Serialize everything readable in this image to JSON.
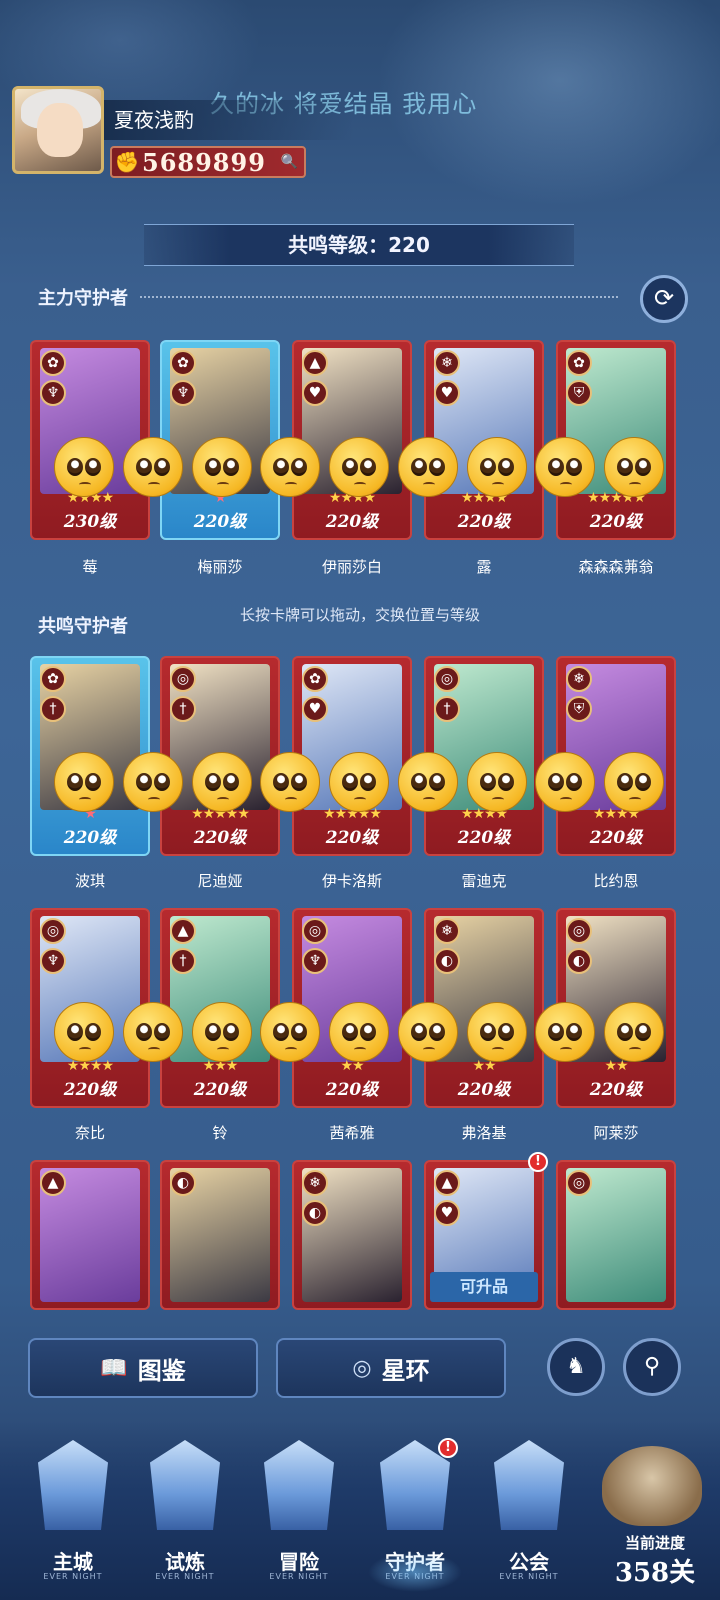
{
  "header": {
    "banner_text": "久的冰 将爱结晶 我用心",
    "player_name": "夏夜浅酌",
    "power": "5689899"
  },
  "resonance": {
    "label": "共鸣等级：220"
  },
  "sections": {
    "main_title": "主力守护者",
    "resonance_title": "共鸣守护者",
    "hint": "长按卡牌可以拖动，交换位置与等级"
  },
  "main_guardians": [
    {
      "name": "莓",
      "level": "230级",
      "stars": "★★★★",
      "frame": "red",
      "badge1": "✿",
      "badge2": "♆"
    },
    {
      "name": "梅丽莎",
      "level": "220级",
      "stars": "★",
      "frame": "blue",
      "badge1": "✿",
      "badge2": "♆"
    },
    {
      "name": "伊丽莎白",
      "level": "220级",
      "stars": "★★★★",
      "frame": "red",
      "badge1": "▲",
      "badge2": "♥"
    },
    {
      "name": "露",
      "level": "220级",
      "stars": "★★★★",
      "frame": "red",
      "badge1": "❄",
      "badge2": "♥"
    },
    {
      "name": "森森森茀翁",
      "level": "220级",
      "stars": "★★★★★",
      "frame": "red",
      "badge1": "✿",
      "badge2": "⛨"
    }
  ],
  "resonance_row1": [
    {
      "name": "波琪",
      "level": "220级",
      "stars": "★",
      "frame": "blue",
      "badge1": "✿",
      "badge2": "†"
    },
    {
      "name": "尼迪娅",
      "level": "220级",
      "stars": "★★★★★",
      "frame": "red",
      "badge1": "◎",
      "badge2": "†"
    },
    {
      "name": "伊卡洛斯",
      "level": "220级",
      "stars": "★★★★★",
      "frame": "red",
      "badge1": "✿",
      "badge2": "♥"
    },
    {
      "name": "雷迪克",
      "level": "220级",
      "stars": "★★★★",
      "frame": "red",
      "badge1": "◎",
      "badge2": "†"
    },
    {
      "name": "比约恩",
      "level": "220级",
      "stars": "★★★★",
      "frame": "red",
      "badge1": "❄",
      "badge2": "⛨"
    }
  ],
  "resonance_row2": [
    {
      "name": "奈比",
      "level": "220级",
      "stars": "★★★★",
      "frame": "red",
      "badge1": "◎",
      "badge2": "♆"
    },
    {
      "name": "铃",
      "level": "220级",
      "stars": "★★★",
      "frame": "red",
      "badge1": "▲",
      "badge2": "†"
    },
    {
      "name": "茜希雅",
      "level": "220级",
      "stars": "★★",
      "frame": "red",
      "badge1": "◎",
      "badge2": "♆"
    },
    {
      "name": "弗洛基",
      "level": "220级",
      "stars": "★★",
      "frame": "red",
      "badge1": "❄",
      "badge2": "◐"
    },
    {
      "name": "阿莱莎",
      "level": "220级",
      "stars": "★★",
      "frame": "red",
      "badge1": "◎",
      "badge2": "◐"
    }
  ],
  "resonance_row3": [
    {
      "badge1": "▲"
    },
    {
      "badge1": "◐"
    },
    {
      "badge1": "❄",
      "badge2": "◐"
    },
    {
      "badge1": "▲",
      "badge2": "♥",
      "upgrade": "可升品"
    },
    {
      "badge1": "◎"
    }
  ],
  "actions": {
    "codex": "图鉴",
    "star_ring": "星环"
  },
  "nav": {
    "main_city": "主城",
    "trial": "试炼",
    "adventure": "冒险",
    "guardian": "守护者",
    "guild": "公会",
    "sub": "EVER NIGHT"
  },
  "progress": {
    "caption": "当前进度",
    "stage": "358关"
  },
  "colors": {
    "card_red": "#a52228",
    "card_blue": "#3aa3dc",
    "bg": "#3d6596"
  }
}
